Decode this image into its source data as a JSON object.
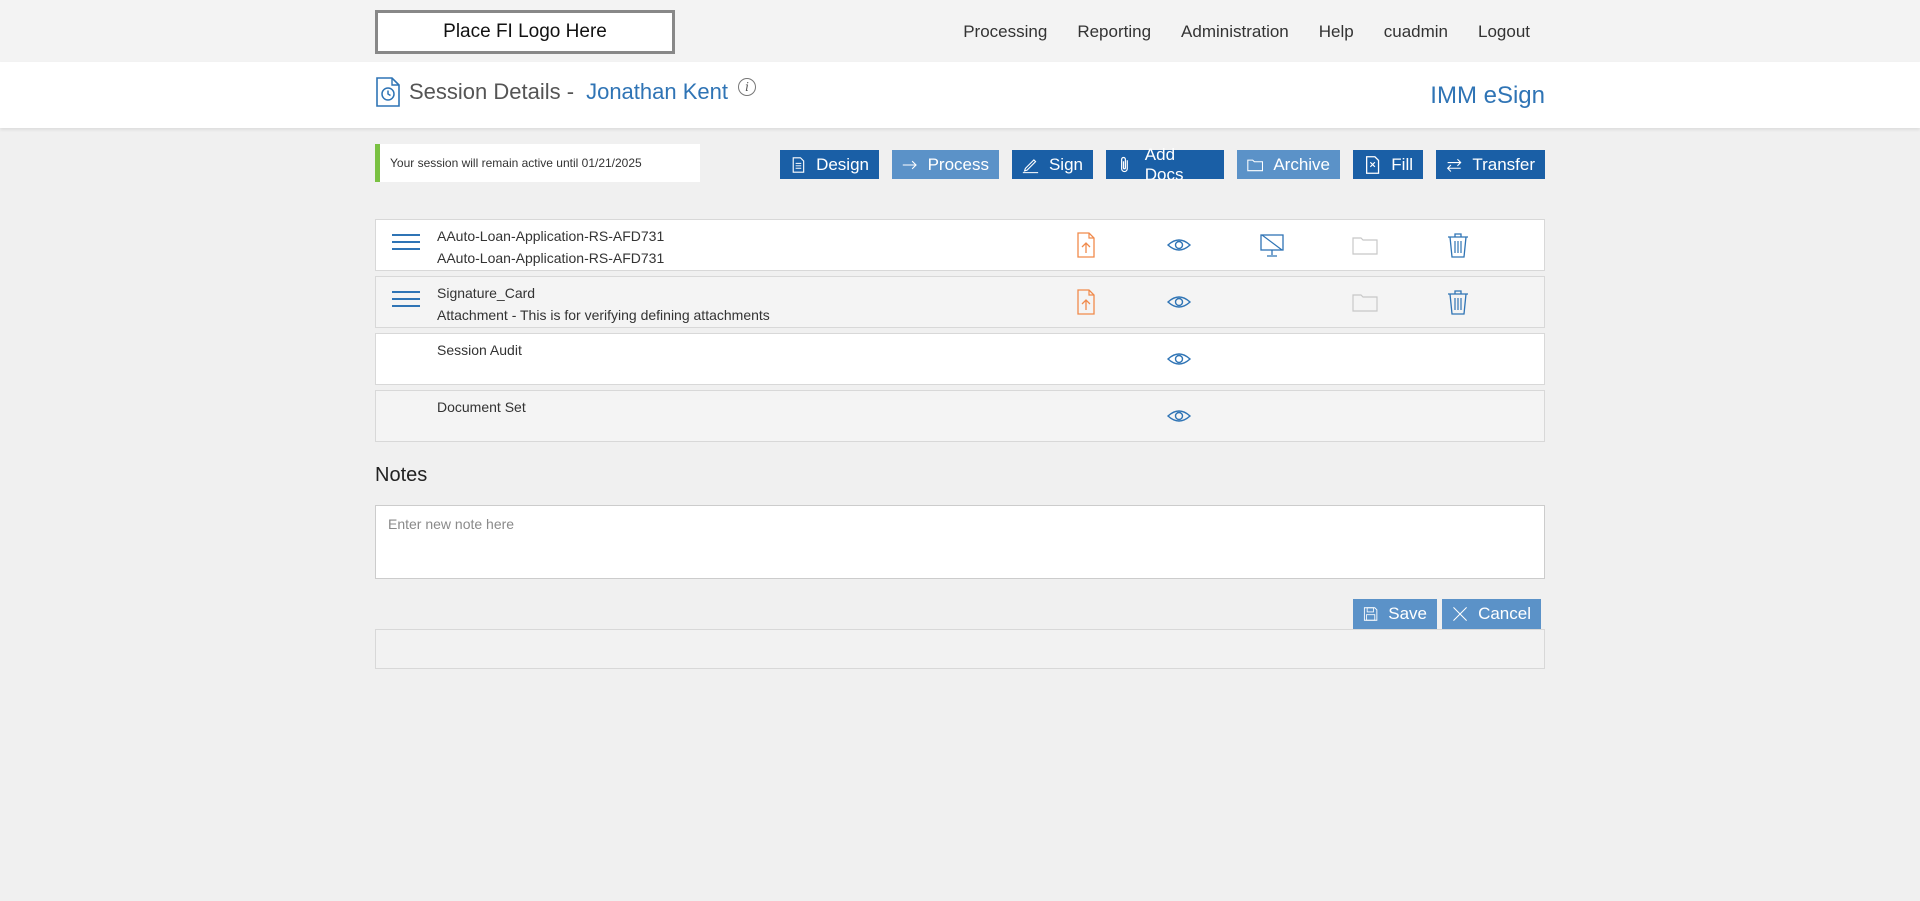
{
  "nav": {
    "logo_text": "Place FI Logo Here",
    "items": [
      "Processing",
      "Reporting",
      "Administration",
      "Help",
      "cuadmin",
      "Logout"
    ]
  },
  "header": {
    "title_prefix": "Session Details -",
    "customer_name": "Jonathan Kent",
    "info_glyph": "i",
    "app_name": "IMM eSign"
  },
  "notice": {
    "text": "Your session will remain active until 01/21/2025",
    "accent_color": "#7ac142"
  },
  "actions": {
    "design": "Design",
    "process": "Process",
    "sign": "Sign",
    "add_docs": "Add Docs",
    "archive": "Archive",
    "fill": "Fill",
    "transfer": "Transfer"
  },
  "documents": [
    {
      "name": "AAuto-Loan-Application-RS-AFD731",
      "description": "AAuto-Loan-Application-RS-AFD731",
      "icons": [
        "drag-handle-icon",
        "upload-pdf-icon",
        "view-eye-icon",
        "no-screen-icon",
        "folder-icon",
        "trash-icon"
      ]
    },
    {
      "name": "Signature_Card",
      "description": "Attachment - This is for verifying defining attachments",
      "icons": [
        "drag-handle-icon",
        "upload-pdf-icon",
        "view-eye-icon",
        "folder-icon",
        "trash-icon"
      ]
    },
    {
      "name": "Session Audit",
      "description": "",
      "icons": [
        "view-eye-icon"
      ]
    },
    {
      "name": "Document Set",
      "description": "",
      "icons": [
        "view-eye-icon"
      ]
    }
  ],
  "notes": {
    "title": "Notes",
    "placeholder": "Enter new note here",
    "value": ""
  },
  "form_buttons": {
    "save": "Save",
    "cancel": "Cancel"
  },
  "colors": {
    "primary_blue": "#1a5fa6",
    "light_blue": "#5b92c8",
    "link_blue": "#2f74b5",
    "upload_orange": "#f08a4b"
  }
}
